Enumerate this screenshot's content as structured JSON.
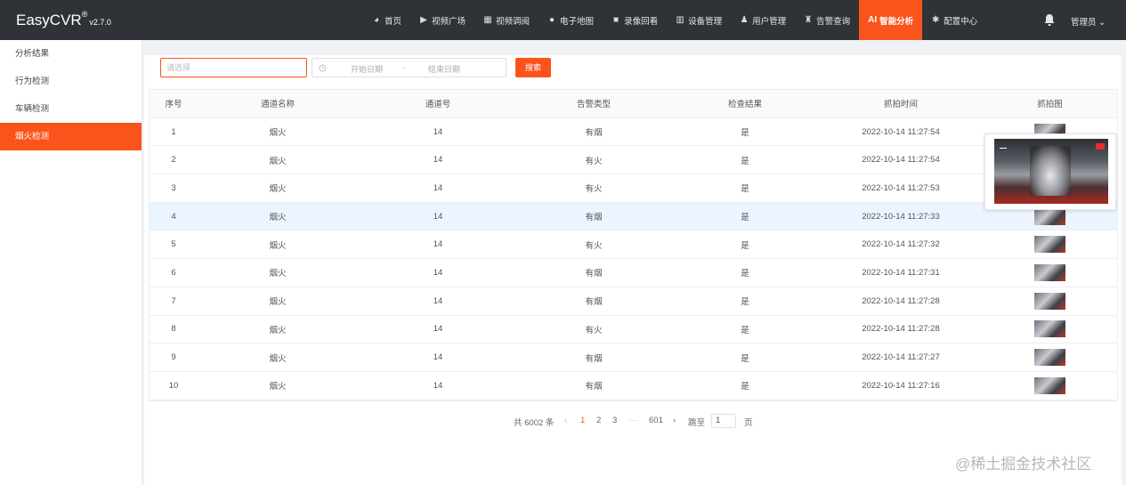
{
  "header": {
    "brand": "EasyCVR",
    "brand_mark": "®",
    "version": "v2.7.0",
    "nav": [
      {
        "label": "首页",
        "icon": "dashboard-icon"
      },
      {
        "label": "视频广场",
        "icon": "play-icon"
      },
      {
        "label": "视频调阅",
        "icon": "grid-icon"
      },
      {
        "label": "电子地图",
        "icon": "location-icon"
      },
      {
        "label": "录像回看",
        "icon": "camera-icon"
      },
      {
        "label": "设备管理",
        "icon": "device-icon"
      },
      {
        "label": "用户管理",
        "icon": "user-icon"
      },
      {
        "label": "告警查询",
        "icon": "alarm-icon"
      },
      {
        "label": "智能分析",
        "prefix": "AI",
        "icon": "ai-icon",
        "active": true
      },
      {
        "label": "配置中心",
        "icon": "gear-icon"
      }
    ],
    "user": "管理员",
    "user_caret": "⌄"
  },
  "sidebar": {
    "items": [
      {
        "label": "分析结果"
      },
      {
        "label": "行为检测"
      },
      {
        "label": "车辆检测"
      },
      {
        "label": "烟火检测",
        "active": true
      }
    ]
  },
  "filter": {
    "select_placeholder": "请选择",
    "start_placeholder": "开始日期",
    "separator": "-",
    "end_placeholder": "结束日期",
    "search_label": "搜索"
  },
  "table": {
    "columns": [
      "序号",
      "通道名称",
      "通道号",
      "告警类型",
      "检查结果",
      "抓拍时间",
      "抓拍图"
    ],
    "rows": [
      [
        "1",
        "烟火",
        "14",
        "有烟",
        "是",
        "2022-10-14 11:27:54"
      ],
      [
        "2",
        "烟火",
        "14",
        "有火",
        "是",
        "2022-10-14 11:27:54"
      ],
      [
        "3",
        "烟火",
        "14",
        "有火",
        "是",
        "2022-10-14 11:27:53"
      ],
      [
        "4",
        "烟火",
        "14",
        "有烟",
        "是",
        "2022-10-14 11:27:33"
      ],
      [
        "5",
        "烟火",
        "14",
        "有火",
        "是",
        "2022-10-14 11:27:32"
      ],
      [
        "6",
        "烟火",
        "14",
        "有烟",
        "是",
        "2022-10-14 11:27:31"
      ],
      [
        "7",
        "烟火",
        "14",
        "有烟",
        "是",
        "2022-10-14 11:27:28"
      ],
      [
        "8",
        "烟火",
        "14",
        "有火",
        "是",
        "2022-10-14 11:27:28"
      ],
      [
        "9",
        "烟火",
        "14",
        "有烟",
        "是",
        "2022-10-14 11:27:27"
      ],
      [
        "10",
        "烟火",
        "14",
        "有烟",
        "是",
        "2022-10-14 11:27:16"
      ]
    ],
    "highlighted_row": 4
  },
  "pagination": {
    "total": "共 6002 条",
    "prev": "‹",
    "pages": [
      "1",
      "2",
      "3"
    ],
    "current": "1",
    "ellipsis": "···",
    "last": "601",
    "next": "›",
    "goto_label": "跳至",
    "goto_value": "1",
    "page_unit": "页"
  },
  "watermark": "@稀土掘金技术社区",
  "colors": {
    "accent": "#fa541c",
    "header_bg": "#2f3338",
    "highlight_row": "#ecf5ff"
  }
}
